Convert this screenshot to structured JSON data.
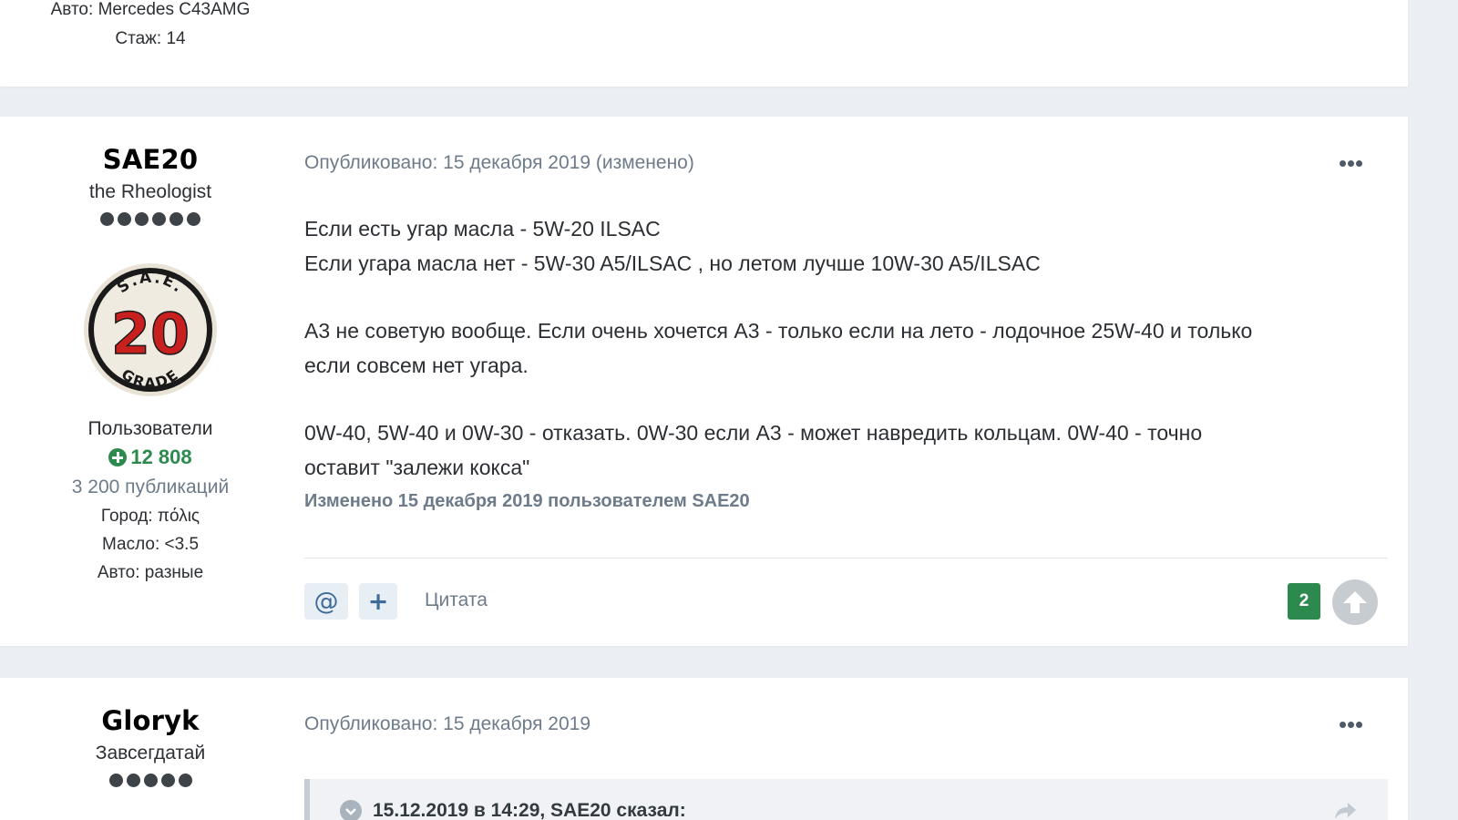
{
  "posts": [
    {
      "author": {
        "auto_label": "Авто:",
        "auto_value": "Mercedes C43AMG",
        "exp_label": "Стаж:",
        "exp_value": "14"
      }
    },
    {
      "author": {
        "name": "SAE20",
        "title": "the Rheologist",
        "avatar": {
          "top_text": "S.A.E.",
          "number": "20",
          "bottom_text": "GRADE"
        },
        "group": "Пользователи",
        "reputation": "12 808",
        "post_count": "3 200 публикаций",
        "city_label": "Город:",
        "city_value": "πόλις",
        "oil_label": "Масло:",
        "oil_value": "<3.5",
        "auto_label": "Авто:",
        "auto_value": "разные"
      },
      "meta": "Опубликовано: 15 декабря 2019 (изменено)",
      "body": {
        "line1": "Если есть угар масла - 5W-20 ILSAC",
        "line2": "Если угара масла нет - 5W-30 A5/ILSAC , но летом лучше 10W-30 A5/ILSAC",
        "line3": "А3 не советую вообще. Если очень хочется А3 - только если на лето - лодочное 25W-40 и только",
        "line4": "если совсем нет угара.",
        "line5": "0W-40, 5W-40 и 0W-30 - отказать. 0W-30 если А3 - может навредить кольцам. 0W-40 - точно",
        "line6": "оставит \"залежи кокса\""
      },
      "edited": "Изменено 15 декабря 2019 пользователем SAE20",
      "actions": {
        "mention": "@",
        "plus": "+",
        "quote": "Цитата",
        "rep_count": "2"
      }
    },
    {
      "author": {
        "name": "Gloryk",
        "title": "Завсегдатай"
      },
      "meta": "Опубликовано: 15 декабря 2019",
      "quote_header": "15.12.2019 в 14:29, SAE20 сказал:"
    }
  ],
  "colors": {
    "page_bg": "#ebeef2",
    "accent_green": "#2d8a4f",
    "meta_gray": "#6d7b8a",
    "link_blue": "#3e6b99"
  }
}
